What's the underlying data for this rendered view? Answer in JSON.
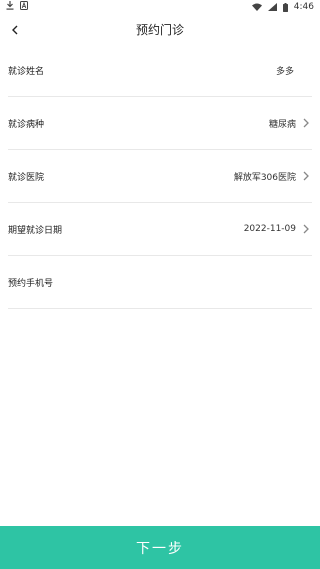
{
  "status_bar": {
    "time": "4:46"
  },
  "header": {
    "title": "预约门诊"
  },
  "form": {
    "rows": [
      {
        "label": "就诊姓名",
        "value": "多多"
      },
      {
        "label": "就诊病种",
        "value": "糖尿病"
      },
      {
        "label": "就诊医院",
        "value": "解放军306医院"
      },
      {
        "label": "期望就诊日期",
        "value": "2022-11-09"
      },
      {
        "label": "预约手机号",
        "value": ""
      }
    ]
  },
  "footer": {
    "next_label": "下一步"
  },
  "colors": {
    "accent": "#2ec4a4",
    "divider": "#e8e8e8"
  }
}
